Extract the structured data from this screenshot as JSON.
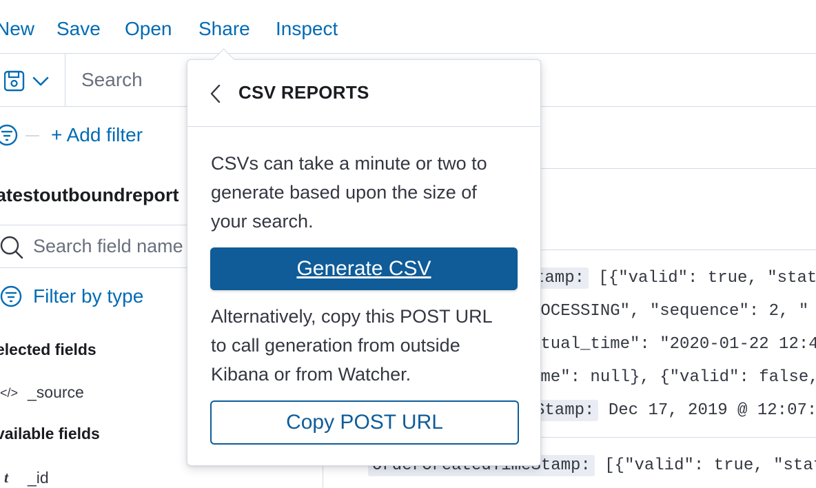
{
  "topnav": {
    "new": "New",
    "save": "Save",
    "open": "Open",
    "share": "Share",
    "inspect": "Inspect"
  },
  "query_bar": {
    "search_placeholder": "Search"
  },
  "filter_bar": {
    "add_filter": "+ Add filter"
  },
  "sidebar": {
    "index_pattern": "atestoutboundreport",
    "search_field_placeholder": "Search field name",
    "filter_by_type": "Filter by type",
    "selected_fields_title": "elected fields",
    "selected_fields": [
      {
        "type": "</>",
        "name": "_source"
      }
    ],
    "available_fields_title": "vailable fields",
    "available_fields": [
      {
        "type": "t",
        "name": "_id"
      }
    ]
  },
  "documents": [
    {
      "key": "tamp:",
      "value": "[{\"valid\": true, \"stat"
    },
    {
      "key": "",
      "value": "ROCESSING\", \"sequence\": 2, \""
    },
    {
      "key": "",
      "value": "ctual_time\": \"2020-01-22 12:4"
    },
    {
      "key": "",
      "value": "ime\": null}, {\"valid\": false,"
    },
    {
      "key": "Stamp:",
      "value": "Dec 17, 2019 @ 12:07:"
    },
    {
      "key": "OrderCreatedTimeStamp:",
      "value": "[{\"valid\": true, \"stat"
    }
  ],
  "popover": {
    "title": "CSV REPORTS",
    "description_lines": [
      "CSVs can take a minute or two to",
      "generate based upon the size of",
      "your search."
    ],
    "generate_button": "Generate CSV",
    "alternative_lines": [
      "Alternatively, copy this POST URL",
      "to call generation from outside",
      "Kibana or from Watcher."
    ],
    "copy_button": "Copy POST URL"
  },
  "colors": {
    "link": "#006bb4",
    "primary": "#0f5c98",
    "border": "#d3dae6"
  }
}
